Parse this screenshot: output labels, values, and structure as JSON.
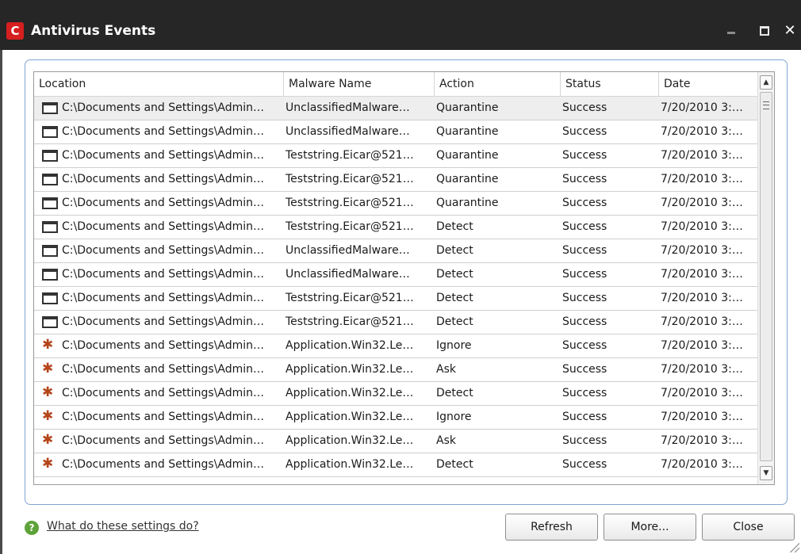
{
  "window": {
    "title": "Antivirus Events",
    "logo_letter": "C",
    "close_glyph": "✕"
  },
  "columns": [
    "Location",
    "Malware Name",
    "Action",
    "Status",
    "Date"
  ],
  "rows": [
    {
      "icon": "file-icon",
      "location": "C:\\Documents and Settings\\Admin…",
      "malware": "UnclassifiedMalware…",
      "action": "Quarantine",
      "status": "Success",
      "date": "7/20/2010 3:…"
    },
    {
      "icon": "file-icon",
      "location": "C:\\Documents and Settings\\Admin…",
      "malware": "UnclassifiedMalware…",
      "action": "Quarantine",
      "status": "Success",
      "date": "7/20/2010 3:…"
    },
    {
      "icon": "file-icon",
      "location": "C:\\Documents and Settings\\Admin…",
      "malware": "Teststring.Eicar@521…",
      "action": "Quarantine",
      "status": "Success",
      "date": "7/20/2010 3:…"
    },
    {
      "icon": "file-icon",
      "location": "C:\\Documents and Settings\\Admin…",
      "malware": "Teststring.Eicar@521…",
      "action": "Quarantine",
      "status": "Success",
      "date": "7/20/2010 3:…"
    },
    {
      "icon": "file-icon",
      "location": "C:\\Documents and Settings\\Admin…",
      "malware": "Teststring.Eicar@521…",
      "action": "Quarantine",
      "status": "Success",
      "date": "7/20/2010 3:…"
    },
    {
      "icon": "file-icon",
      "location": "C:\\Documents and Settings\\Admin…",
      "malware": "Teststring.Eicar@521…",
      "action": "Detect",
      "status": "Success",
      "date": "7/20/2010 3:…"
    },
    {
      "icon": "file-icon",
      "location": "C:\\Documents and Settings\\Admin…",
      "malware": "UnclassifiedMalware…",
      "action": "Detect",
      "status": "Success",
      "date": "7/20/2010 3:…"
    },
    {
      "icon": "file-icon",
      "location": "C:\\Documents and Settings\\Admin…",
      "malware": "UnclassifiedMalware…",
      "action": "Detect",
      "status": "Success",
      "date": "7/20/2010 3:…"
    },
    {
      "icon": "file-icon",
      "location": "C:\\Documents and Settings\\Admin…",
      "malware": "Teststring.Eicar@521…",
      "action": "Detect",
      "status": "Success",
      "date": "7/20/2010 3:…"
    },
    {
      "icon": "file-icon",
      "location": "C:\\Documents and Settings\\Admin…",
      "malware": "Teststring.Eicar@521…",
      "action": "Detect",
      "status": "Success",
      "date": "7/20/2010 3:…"
    },
    {
      "icon": "bug-icon",
      "location": "C:\\Documents and Settings\\Admin…",
      "malware": "Application.Win32.Le…",
      "action": "Ignore",
      "status": "Success",
      "date": "7/20/2010 3:…"
    },
    {
      "icon": "bug-icon",
      "location": "C:\\Documents and Settings\\Admin…",
      "malware": "Application.Win32.Le…",
      "action": "Ask",
      "status": "Success",
      "date": "7/20/2010 3:…"
    },
    {
      "icon": "bug-icon",
      "location": "C:\\Documents and Settings\\Admin…",
      "malware": "Application.Win32.Le…",
      "action": "Detect",
      "status": "Success",
      "date": "7/20/2010 3:…"
    },
    {
      "icon": "bug-icon",
      "location": "C:\\Documents and Settings\\Admin…",
      "malware": "Application.Win32.Le…",
      "action": "Ignore",
      "status": "Success",
      "date": "7/20/2010 3:…"
    },
    {
      "icon": "bug-icon",
      "location": "C:\\Documents and Settings\\Admin…",
      "malware": "Application.Win32.Le…",
      "action": "Ask",
      "status": "Success",
      "date": "7/20/2010 3:…"
    },
    {
      "icon": "bug-icon",
      "location": "C:\\Documents and Settings\\Admin…",
      "malware": "Application.Win32.Le…",
      "action": "Detect",
      "status": "Success",
      "date": "7/20/2010 3:…"
    }
  ],
  "footer": {
    "help_link": "What do these settings do?",
    "help_glyph": "?",
    "refresh_label": "Refresh",
    "more_label": "More...",
    "close_label": "Close"
  },
  "colors": {
    "titlebar": "#262626",
    "logo": "#d61f1f",
    "panel_border": "#7fa6d1",
    "help_icon": "#5ea33a"
  }
}
